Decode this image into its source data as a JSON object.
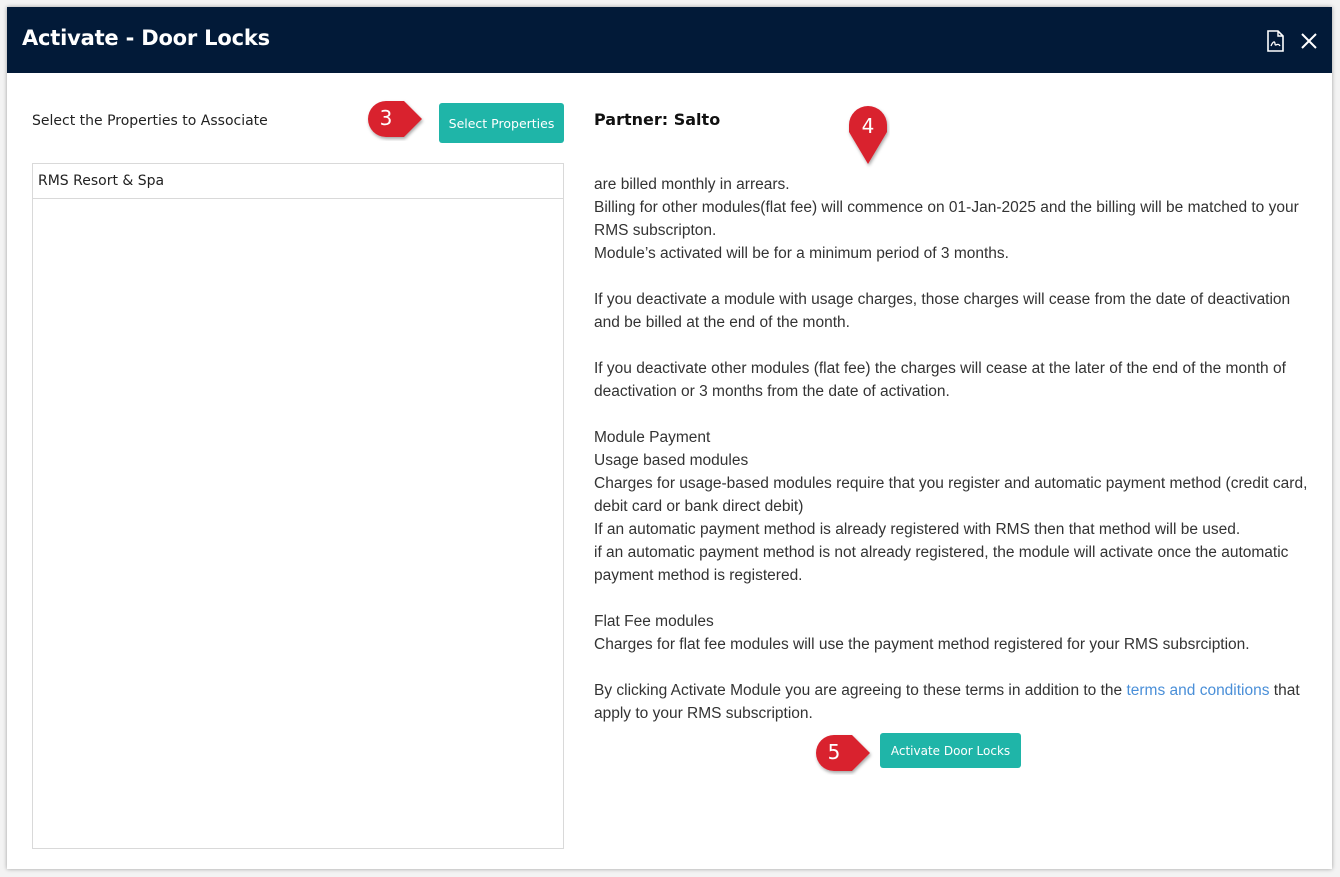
{
  "dialog": {
    "title": "Activate - Door Locks",
    "icons": {
      "export": "pdf-file-icon",
      "close": "close-icon"
    }
  },
  "left_panel": {
    "label": "Select the Properties to Associate",
    "select_button": "Select Properties",
    "properties": [
      "RMS Resort & Spa"
    ]
  },
  "right_panel": {
    "partner_label": "Partner: Salto",
    "terms": {
      "partial_top": "are billed monthly in arrears.",
      "billing_1": "Billing for other modules(flat fee) will commence on 01-Jan-2025 and the billing will be matched to your RMS subscripton.",
      "billing_2": "Module’s activated will be for a minimum period of 3 months.",
      "deactivate_usage": "If you deactivate a module with usage charges, those charges will cease from the date of deactivation and be billed at the end of the month.",
      "deactivate_flat": "If you deactivate other modules (flat fee) the charges will cease at the later of the end of the month of deactivation or 3 months from the date of activation.",
      "payment_heading": "Module Payment",
      "usage_heading": "Usage based modules",
      "usage_1": "Charges for usage-based modules require that you register and automatic payment method (credit card, debit card or bank direct debit)",
      "usage_2": "If an automatic payment method is already registered with RMS then that method will be used.",
      "usage_3": "if an automatic payment method is not already registered, the module will activate once the automatic payment method is registered.",
      "flat_heading": "Flat Fee modules",
      "flat_1": "Charges for flat fee modules will use the payment method registered for your RMS subsrciption.",
      "agree_before": "By clicking Activate Module you are agreeing to these terms in addition to the ",
      "agree_link": "terms and conditions",
      "agree_after": " that apply to your RMS subscription."
    },
    "activate_button": "Activate Door Locks"
  },
  "callouts": [
    "3",
    "4",
    "5"
  ],
  "colors": {
    "header": "#021a38",
    "button": "#1fb5a8",
    "callout": "#d9202f",
    "link": "#4a8fd8"
  }
}
